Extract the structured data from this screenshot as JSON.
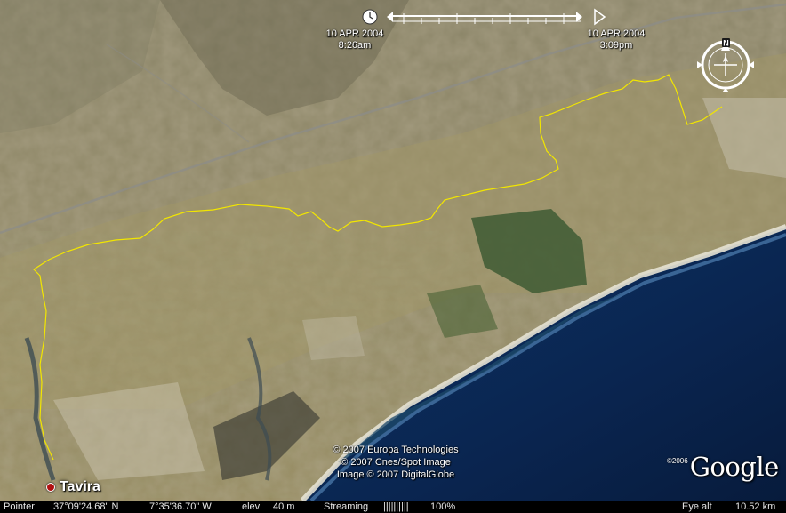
{
  "timeslider": {
    "start_date": "10 APR 2004",
    "start_time": "8:26am",
    "end_date": "10 APR 2004",
    "end_time": "3:09pm"
  },
  "compass": {
    "north_label": "N"
  },
  "place": {
    "name": "Tavira"
  },
  "copyright": {
    "line1": "© 2007 Europa Technologies",
    "line2": "© 2007 Cnes/Spot Image",
    "line3": "Image © 2007 DigitalGlobe"
  },
  "logo": {
    "year": "©2006",
    "word": "Google"
  },
  "status": {
    "pointer_label": "Pointer",
    "lat": "37°09'24.68\" N",
    "lon": "7°35'36.70\" W",
    "elev_label": "elev",
    "elev_value": "40 m",
    "streaming_label": "Streaming",
    "streaming_bars": "||||||||||",
    "streaming_pct": "100%",
    "eye_label": "Eye alt",
    "eye_value": "10.52 km"
  },
  "colors": {
    "track": "#f2e600",
    "ocean": "#0a2a5a",
    "land": "#8f8560",
    "status_bg": "#000000"
  },
  "icons": [
    "clock-icon",
    "play-icon",
    "compass-icon"
  ]
}
